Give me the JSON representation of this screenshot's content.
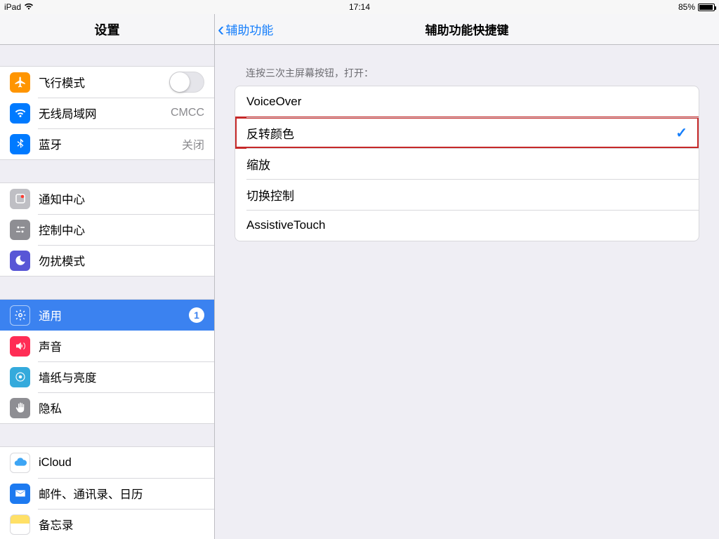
{
  "status": {
    "device": "iPad",
    "time": "17:14",
    "battery_pct": "85%"
  },
  "sidebar": {
    "title": "设置",
    "groups": [
      {
        "key": "g1",
        "rows": [
          {
            "key": "airplane",
            "label": "飞行模式",
            "type": "switch"
          },
          {
            "key": "wifi",
            "label": "无线局域网",
            "accessory": "CMCC"
          },
          {
            "key": "bluetooth",
            "label": "蓝牙",
            "accessory": "关闭"
          }
        ]
      },
      {
        "key": "g2",
        "rows": [
          {
            "key": "notif",
            "label": "通知中心"
          },
          {
            "key": "control",
            "label": "控制中心"
          },
          {
            "key": "dnd",
            "label": "勿扰模式"
          }
        ]
      },
      {
        "key": "g3",
        "rows": [
          {
            "key": "general",
            "label": "通用",
            "selected": true,
            "badge": "1"
          },
          {
            "key": "sound",
            "label": "声音"
          },
          {
            "key": "wall",
            "label": "墙纸与亮度"
          },
          {
            "key": "privacy",
            "label": "隐私"
          }
        ]
      },
      {
        "key": "g4",
        "rows": [
          {
            "key": "icloud",
            "label": "iCloud"
          },
          {
            "key": "mail",
            "label": "邮件、通讯录、日历"
          },
          {
            "key": "notes",
            "label": "备忘录"
          }
        ]
      }
    ]
  },
  "detail": {
    "back_label": "辅助功能",
    "title": "辅助功能快捷键",
    "section_header": "连按三次主屏幕按钮，打开：",
    "options": [
      {
        "key": "voiceover",
        "label": "VoiceOver",
        "checked": false
      },
      {
        "key": "invert",
        "label": "反转颜色",
        "checked": true,
        "highlight": true
      },
      {
        "key": "zoom",
        "label": "缩放",
        "checked": false
      },
      {
        "key": "switchcontrol",
        "label": "切换控制",
        "checked": false
      },
      {
        "key": "assistivetouch",
        "label": "AssistiveTouch",
        "checked": false
      }
    ]
  }
}
